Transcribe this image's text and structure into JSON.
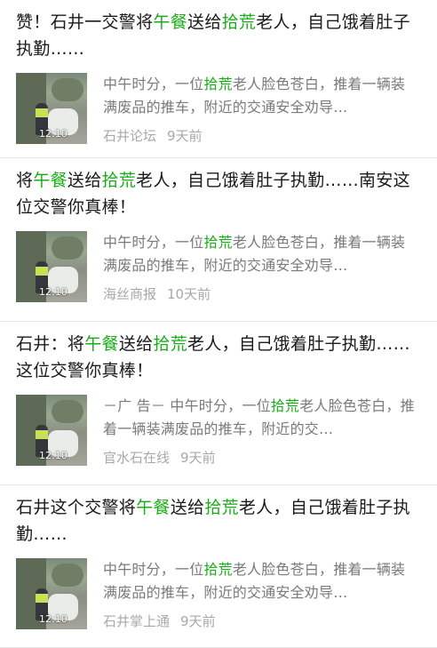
{
  "results": [
    {
      "title_parts": [
        "赞！石井一交警将",
        "午餐",
        "送给",
        "拾荒",
        "老人，自己饿着肚子执勤……"
      ],
      "snippet_parts": [
        "中午时分，一位",
        "拾荒",
        "老人脸色苍白，推着一辆装满废品的推车，附近的交通安全劝导…"
      ],
      "thumb_time": "12:10",
      "source": "石井论坛",
      "time_ago": "9天前"
    },
    {
      "title_parts": [
        "将",
        "午餐",
        "送给",
        "拾荒",
        "老人，自己饿着肚子执勤……南安这位交警你真棒！"
      ],
      "snippet_parts": [
        "中午时分，一位",
        "拾荒",
        "老人脸色苍白，推着一辆装满废品的推车，附近的交通安全劝导…"
      ],
      "thumb_time": "12:10",
      "source": "海丝商报",
      "time_ago": "10天前"
    },
    {
      "title_parts": [
        "石井：将",
        "午餐",
        "送给",
        "拾荒",
        "老人，自己饿着肚子执勤……这位交警你真棒！"
      ],
      "snippet_parts": [
        "－广 告－ 中午时分，一位",
        "拾荒",
        "老人脸色苍白，推着一辆装满废品的推车，附近的交…"
      ],
      "thumb_time": "12:10",
      "source": "官水石在线",
      "time_ago": "9天前"
    },
    {
      "title_parts": [
        "石井这个交警将",
        "午餐",
        "送给",
        "拾荒",
        "老人，自己饿着肚子执勤……"
      ],
      "snippet_parts": [
        "中午时分，一位",
        "拾荒",
        "老人脸色苍白，推着一辆装满废品的推车，附近的交通安全劝导…"
      ],
      "thumb_time": "12:10",
      "source": "石井掌上通",
      "time_ago": "9天前"
    }
  ],
  "colors": {
    "highlight": "#1aad19",
    "snippet": "#7a7a7a",
    "meta": "#a8a8a8",
    "divider": "#e6e6e6"
  },
  "icons": {
    "thumbnail": "photo-thumbnail"
  }
}
